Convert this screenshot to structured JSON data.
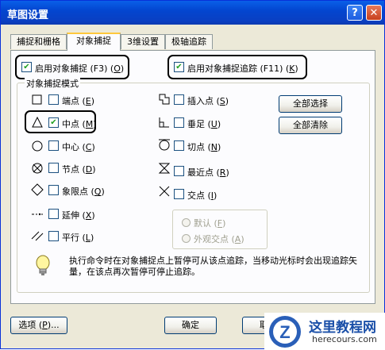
{
  "window": {
    "title": "草图设置",
    "help_btn": "?",
    "close_btn": "✕"
  },
  "tabs": [
    "捕捉和栅格",
    "对象捕捉",
    "3维设置",
    "极轴追踪"
  ],
  "top_options": {
    "enable_snap": {
      "label": "启用对象捕捉 (F3) ",
      "key": "O",
      "checked": true
    },
    "enable_track": {
      "label": "启用对象捕捉追踪 (F11) ",
      "key": "K",
      "checked": true
    }
  },
  "group_title": "对象捕捉模式",
  "modes_left": [
    {
      "label": "端点 ",
      "key": "E",
      "checked": false
    },
    {
      "label": "中点 ",
      "key": "M",
      "checked": true
    },
    {
      "label": "中心 ",
      "key": "C",
      "checked": false
    },
    {
      "label": "节点 ",
      "key": "D",
      "checked": false
    },
    {
      "label": "象限点 ",
      "key": "Q",
      "checked": false
    },
    {
      "label": "延伸 ",
      "key": "X",
      "checked": false
    },
    {
      "label": "平行 ",
      "key": "L",
      "checked": false
    }
  ],
  "modes_right": [
    {
      "label": "插入点 ",
      "key": "S",
      "checked": false
    },
    {
      "label": "垂足 ",
      "key": "U",
      "checked": false
    },
    {
      "label": "切点 ",
      "key": "N",
      "checked": false
    },
    {
      "label": "最近点 ",
      "key": "R",
      "checked": false
    },
    {
      "label": "交点 ",
      "key": "I",
      "checked": false
    }
  ],
  "buttons": {
    "select_all": "全部选择",
    "clear_all": "全部清除"
  },
  "radios": [
    {
      "label": "默认 ",
      "key": "F"
    },
    {
      "label": "外观交点 ",
      "key": "A"
    }
  ],
  "info_text": "执行命令时在对象捕捉点上暂停可从该点追踪，当移动光标时会出现追踪矢量，在该点再次暂停可停止追踪。",
  "footer": {
    "options_label": "选项 ",
    "options_key": "P",
    "options_suffix": "...",
    "ok": "确定",
    "cancel": "取消"
  },
  "watermark": {
    "title": "这里教程网",
    "url": "herecours.com",
    "letter": "Z"
  },
  "colors": {
    "title_bar": "#0a5fe8",
    "window_bg": "#ece9d8",
    "check": "#21a121",
    "tab_highlight": "#ffc83c"
  }
}
